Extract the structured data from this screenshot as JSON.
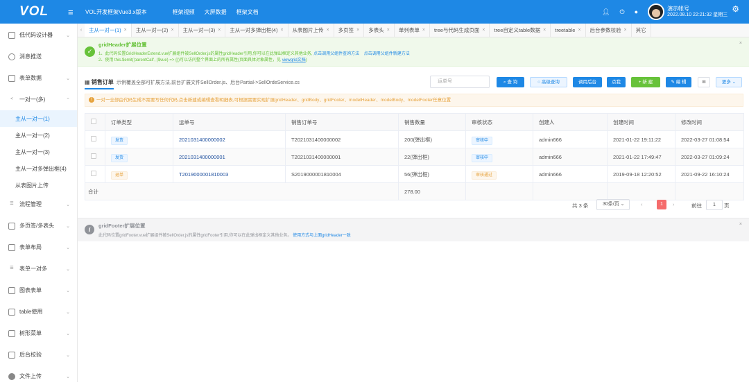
{
  "header": {
    "logo": "VOL",
    "app_name": "VOL开发框架Vue3.x版本",
    "nav": [
      "框架视频",
      "大屏数据",
      "框架文档"
    ],
    "user_name": "演示帐号",
    "datetime": "2022.08.10 22:21:32 星期三"
  },
  "sidebar": {
    "items": [
      {
        "label": "低代码设计器"
      },
      {
        "label": "消息推送"
      },
      {
        "label": "表单数据"
      },
      {
        "label": "一对一(多)"
      }
    ],
    "subitems": [
      "主从一对一(1)",
      "主从一对一(2)",
      "主从一对一(3)",
      "主从一对多弹出框(4)",
      "从表图片上传"
    ],
    "items2": [
      {
        "label": "流程管理"
      },
      {
        "label": "多页签/多表头"
      },
      {
        "label": "表单布局"
      },
      {
        "label": "表单一对多"
      },
      {
        "label": "图表表单"
      },
      {
        "label": "table使用"
      },
      {
        "label": "树形菜单"
      },
      {
        "label": "后台校验"
      },
      {
        "label": "文件上传"
      }
    ]
  },
  "tabs": [
    "主从一对一(1)",
    "主从一对一(2)",
    "主从一对一(3)",
    "主从一对多弹出框(4)",
    "从表图片上传",
    "多页签",
    "多表头",
    "单列表单",
    "tree与代码生成页面",
    "tree自定义table数据",
    "treetable",
    "后台参数校验",
    "其它"
  ],
  "header_alert": {
    "title": "gridHeader扩展位置",
    "line1": "1、此代码位置GridHeaderExtend.vue扩展组件被SellOrder.js的属性gridHeader引用,你可以在此弹出框定义其他业务,",
    "line1_link1": "点击调用父组件查询方法",
    "line1_link2": "点击调用父组件新建方法",
    "line2": "2、使用 this.$emit('parentCall', ($vue) => {})可以访问整个界面上的所有属性(页面具体对象属性，见",
    "line2_link": "viewgrid文档",
    "line2_end": ")"
  },
  "toolbar": {
    "title": "销售订单",
    "desc": "示例覆盖全部可扩展方法,前台扩展文件SellOrder.js、后台Partial->SellOrdeService.cs",
    "search_placeholder": "运单号",
    "buttons": {
      "query": "查 询",
      "advanced": "高级查询",
      "call_backend": "调用后台",
      "click_me": "点我",
      "add": "+ 新 建",
      "edit": "编 辑",
      "grid_icon": "⊞",
      "more": "更多"
    }
  },
  "warn_text": "一对一全部由代码生成不需要写任何代码,点击新建或编辑查看明细表,可根据需要实现扩展gridHeader、gridBody、gridFooter、modelHeader、modelBody、modelFooter任意位置",
  "table": {
    "headers": [
      "订单类型",
      "运单号",
      "销售订单号",
      "销售数量",
      "审核状态",
      "创建人",
      "创建时间",
      "修改时间"
    ],
    "rows": [
      {
        "type": "发货",
        "waybill": "2021031400000002",
        "order": "T2021031400000002",
        "qty": "200(弹出框)",
        "status": "审核中",
        "creator": "admin666",
        "created": "2021-01-22 19:11:22",
        "modified": "2022-03-27 01:08:54"
      },
      {
        "type": "发货",
        "waybill": "2021031400000001",
        "order": "T2021031400000001",
        "qty": "22(弹出框)",
        "status": "审核中",
        "creator": "admin666",
        "created": "2021-01-22 17:49:47",
        "modified": "2022-03-27 01:09:24"
      },
      {
        "type": "退单",
        "waybill": "T2019000001810003",
        "order": "S2019000001810004",
        "qty": "56(弹出框)",
        "status": "审核通过",
        "creator": "admin666",
        "created": "2019-09-18 12:20:52",
        "modified": "2021-09-22 16:10:24"
      }
    ],
    "summary_label": "合计",
    "summary_qty": "278.00"
  },
  "pager": {
    "total": "共 3 条",
    "page_size": "30条/页",
    "current": "1",
    "goto": "前往",
    "page_unit": "页"
  },
  "footer_alert": {
    "title": "gridFooter扩展位置",
    "text": "此代码位置gridFooter.vue扩展组件被SellOrder.js的属性gridFooter引用,你可以在此弹出框定义其他业务。",
    "link": "使用方式与上面gridHeader一致"
  }
}
